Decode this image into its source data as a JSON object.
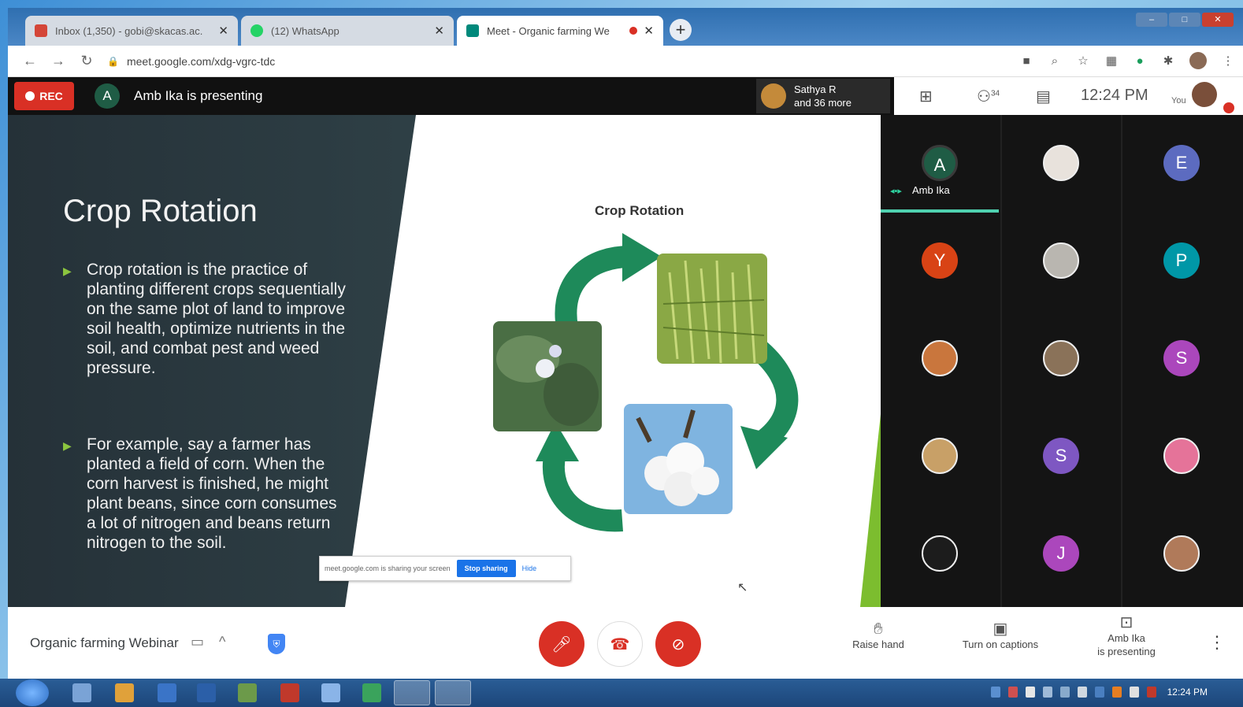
{
  "browser": {
    "tabs": [
      {
        "label": "Inbox (1,350) - gobi@skacas.ac.",
        "icon": "gmail-icon",
        "color": "#d44638"
      },
      {
        "label": "(12) WhatsApp",
        "icon": "whatsapp-icon",
        "color": "#25d366"
      },
      {
        "label": "Meet - Organic farming We",
        "icon": "meet-icon",
        "color": "#00897b"
      }
    ],
    "url": "meet.google.com/xdg-vgrc-tdc"
  },
  "meet": {
    "rec_label": "REC",
    "presenter_initial": "A",
    "presenting_text": "Amb Ika is presenting",
    "others_name": "Sathya R",
    "others_more": "and 36 more",
    "people_count": "34",
    "time": "12:24 PM",
    "you_label": "You",
    "meeting_title": "Organic farming Webinar",
    "raise_hand": "Raise hand",
    "captions": "Turn on captions",
    "presenting_line1": "Amb Ika",
    "presenting_line2": "is presenting"
  },
  "slide": {
    "title": "Crop Rotation",
    "bullet1": "Crop rotation is the practice of planting different crops sequentially on the same plot of land to improve soil health, optimize nutrients in the soil, and combat pest and weed pressure.",
    "bullet2": "For example, say a farmer has planted a field of corn. When the corn harvest is finished, he might plant beans, since corn consumes a lot of nitrogen and beans return nitrogen to the soil.",
    "diagram_title": "Crop Rotation"
  },
  "share_bar": {
    "message": "meet.google.com is sharing your screen",
    "stop": "Stop sharing",
    "hide": "Hide"
  },
  "participants": [
    {
      "initial": "A",
      "name": "Amb Ika",
      "color": "#1f5c45",
      "active": true
    },
    {
      "initial": "",
      "name": "",
      "color": "#e8e2dc"
    },
    {
      "initial": "E",
      "name": "",
      "color": "#5c6bc0"
    },
    {
      "initial": "Y",
      "name": "",
      "color": "#d84315"
    },
    {
      "initial": "",
      "name": "",
      "color": "#b9b6b0"
    },
    {
      "initial": "P",
      "name": "",
      "color": "#0097a7"
    },
    {
      "initial": "",
      "name": "",
      "color": "#c9763d"
    },
    {
      "initial": "",
      "name": "",
      "color": "#8a7259"
    },
    {
      "initial": "S",
      "name": "",
      "color": "#ab47bc"
    },
    {
      "initial": "",
      "name": "",
      "color": "#c8a067"
    },
    {
      "initial": "S",
      "name": "",
      "color": "#7e57c2"
    },
    {
      "initial": "",
      "name": "",
      "color": "#e57399"
    },
    {
      "initial": "",
      "name": "",
      "color": "#1c1c1c"
    },
    {
      "initial": "J",
      "name": "",
      "color": "#ab47bc"
    },
    {
      "initial": "",
      "name": "",
      "color": "#b07a5a"
    }
  ],
  "taskbar": {
    "clock": "12:24 PM"
  }
}
